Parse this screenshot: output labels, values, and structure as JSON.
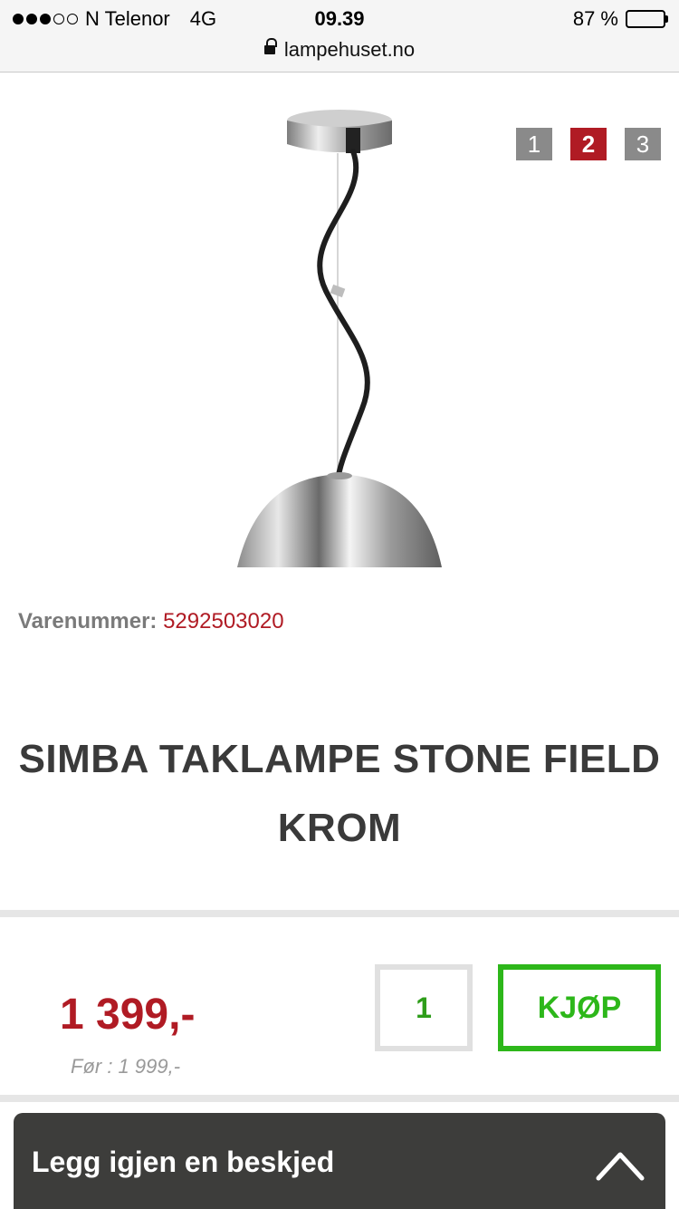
{
  "status_bar": {
    "carrier": "N Telenor",
    "network": "4G",
    "time": "09.39",
    "battery": "87 %",
    "battery_level": 0.87,
    "signal_bars_filled": 3,
    "signal_bars_total": 5
  },
  "browser": {
    "url": "lampehuset.no",
    "lock_icon": "lock-icon"
  },
  "gallery": {
    "pages": [
      "1",
      "2",
      "3"
    ],
    "active_page": "2"
  },
  "product": {
    "sku_label": "Varenummer:",
    "sku": "5292503020",
    "title_line1": "SIMBA TAKLAMPE STONE FIELD",
    "title_line2": "KROM",
    "price": "1 399,-",
    "old_price": "Før : 1 999,-",
    "quantity": "1",
    "buy_label": "KJØP"
  },
  "chat": {
    "label": "Legg igjen en beskjed",
    "icon": "chevron-up-icon"
  },
  "colors": {
    "accent_red": "#b01b24",
    "buy_green": "#2db71a",
    "chat_bg": "#3d3d3b"
  }
}
